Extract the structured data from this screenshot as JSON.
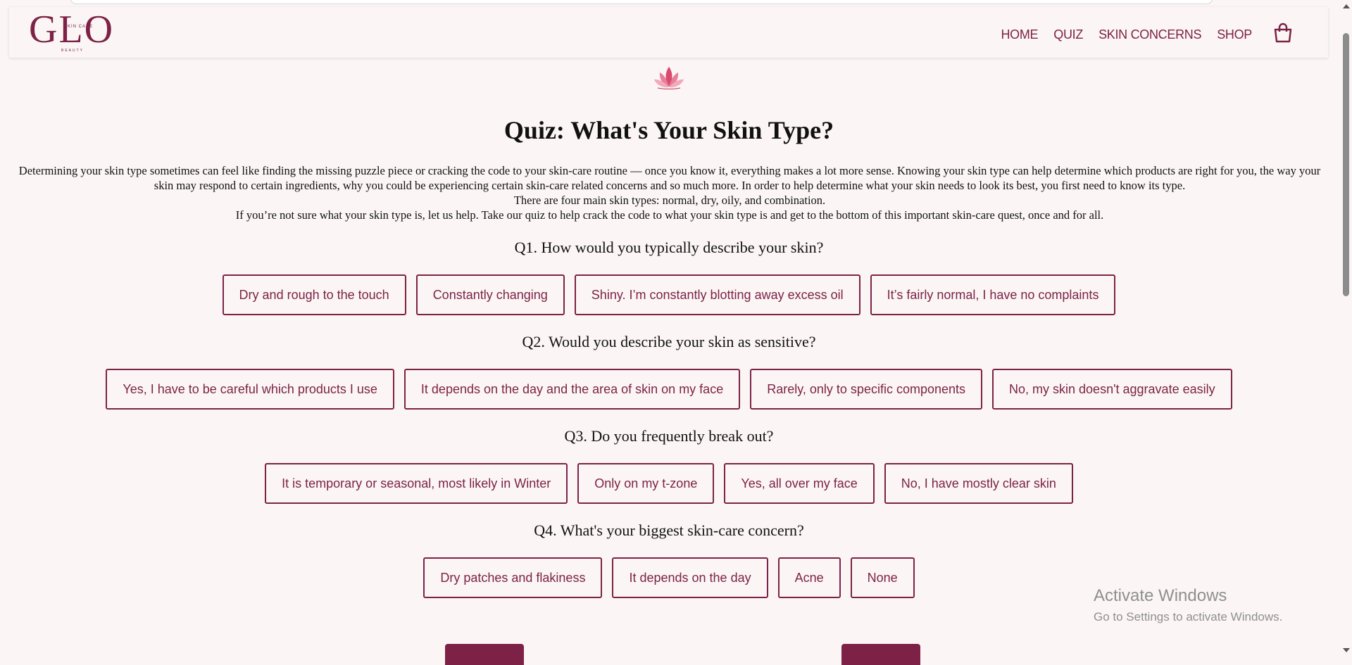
{
  "header": {
    "logo": {
      "main": "GLO",
      "sub": "SKIN CARE",
      "tag": "BEAUTY"
    },
    "nav": [
      {
        "label": "HOME"
      },
      {
        "label": "QUIZ"
      },
      {
        "label": "SKIN CONCERNS"
      },
      {
        "label": "SHOP"
      }
    ],
    "cart_icon": "shopping-bag-icon"
  },
  "brand_color": "#7d2246",
  "title": "Quiz: What's Your Skin Type?",
  "intro": {
    "p1": "Determining your skin type sometimes can feel like finding the missing puzzle piece or cracking the code to your skin-care routine — once you know it, everything makes a lot more sense. Knowing your skin type can help determine which products are right for you, the way your skin may respond to certain ingredients, why you could be experiencing certain skin-care related concerns and so much more. In order to help determine what your skin needs to look its best, you first need to know its type.",
    "p2": "There are four main skin types: normal, dry, oily, and combination.",
    "p3": "If you’re not sure what your skin type is, let us help. Take our quiz to help crack the code to what your skin type is and get to the bottom of this important skin-care quest, once and for all."
  },
  "questions": [
    {
      "question": "Q1. How would you typically describe your skin?",
      "answers": [
        "Dry and rough to the touch",
        "Constantly changing",
        "Shiny. I’m constantly blotting away excess oil",
        "It’s fairly normal, I have no complaints"
      ]
    },
    {
      "question": "Q2. Would you describe your skin as sensitive?",
      "answers": [
        "Yes, I have to be careful which products I use",
        "It depends on the day and the area of skin on my face",
        "Rarely, only to specific components",
        "No, my skin doesn't aggravate easily"
      ]
    },
    {
      "question": "Q3. Do you frequently break out?",
      "answers": [
        "It is temporary or seasonal, most likely in Winter",
        "Only on my t-zone",
        "Yes, all over my face",
        "No, I have mostly clear skin"
      ]
    },
    {
      "question": "Q4. What's your biggest skin-care concern?",
      "answers": [
        "Dry patches and flakiness",
        "It depends on the day",
        "Acne",
        "None"
      ]
    }
  ],
  "watermark": {
    "title": "Activate Windows",
    "subtitle": "Go to Settings to activate Windows."
  }
}
